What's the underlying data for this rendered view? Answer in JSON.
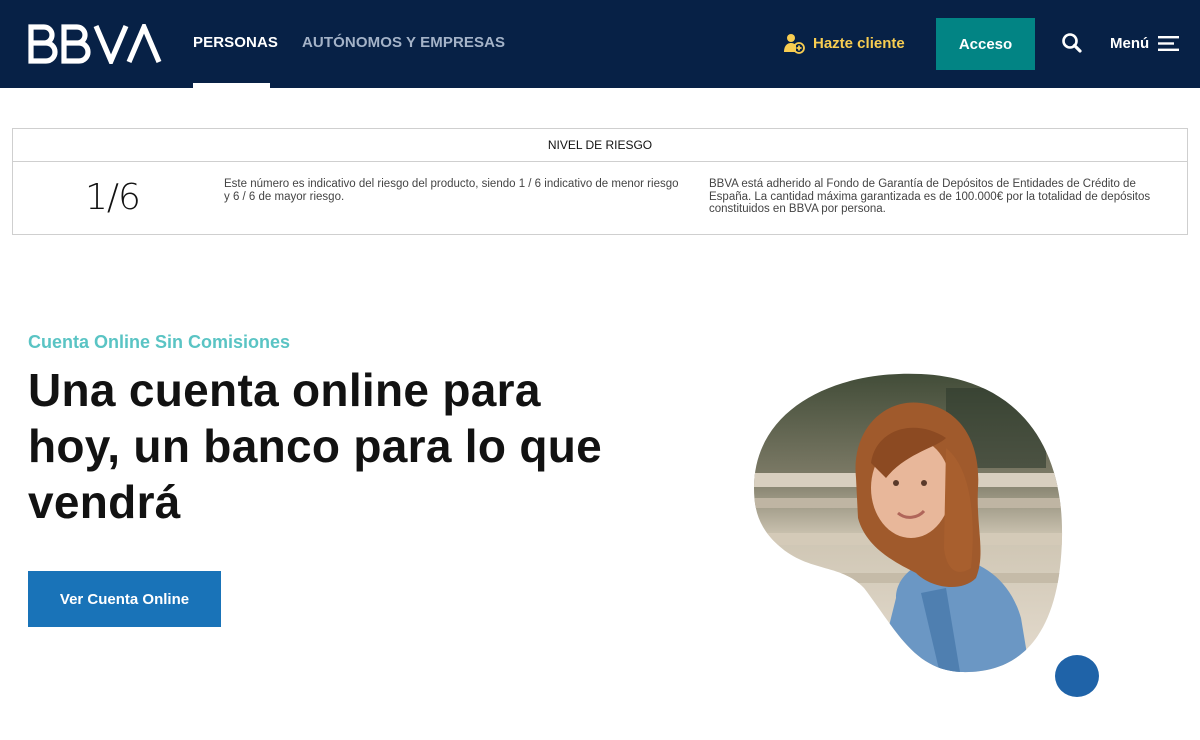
{
  "header": {
    "logo_text": "BBVA",
    "nav": [
      {
        "label": "PERSONAS",
        "active": true
      },
      {
        "label": "AUTÓNOMOS Y EMPRESAS",
        "active": false
      }
    ],
    "hazte_cliente_label": "Hazte cliente",
    "acceso_label": "Acceso",
    "search_icon": "search-icon",
    "menu_label": "Menú",
    "menu_icon": "hamburger-icon"
  },
  "risk": {
    "title": "NIVEL DE RIESGO",
    "level": "1/6",
    "description": "Este número es indicativo del riesgo del producto, siendo 1 / 6 indicativo de menor riesgo y 6 / 6 de mayor riesgo.",
    "guarantee": "BBVA está adherido al Fondo de Garantía de Depósitos de Entidades de Crédito de España. La cantidad máxima garantizada es de 100.000€ por la totalidad de depósitos constituidos en BBVA por persona."
  },
  "hero": {
    "eyebrow": "Cuenta Online Sin Comisiones",
    "headline": "Una cuenta online para hoy, un banco para lo que vendrá",
    "cta_label": "Ver Cuenta Online"
  },
  "colors": {
    "navy": "#072146",
    "teal": "#028484",
    "yellow": "#f8cd51",
    "aqua": "#5ac4c4",
    "blue": "#1973b8"
  }
}
